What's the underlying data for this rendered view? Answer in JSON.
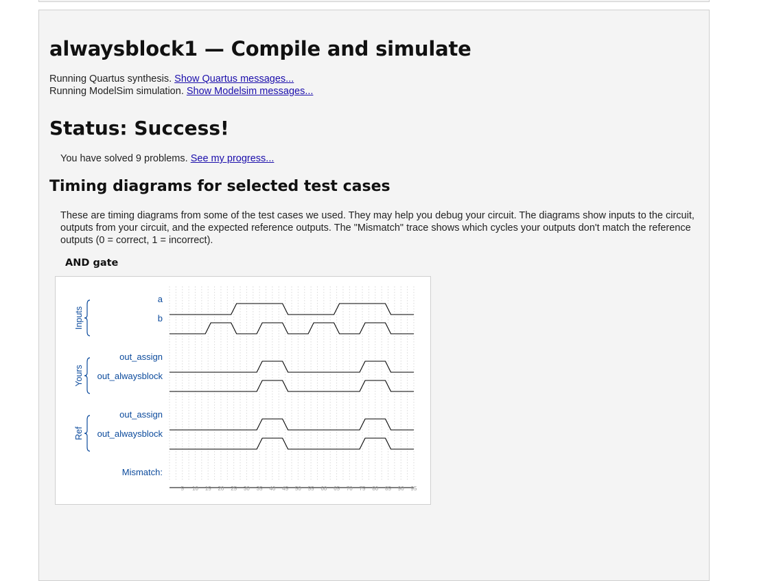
{
  "page": {
    "title": "alwaysblock1 — Compile and simulate",
    "quartus_text": "Running Quartus synthesis.",
    "quartus_link": "Show Quartus messages...",
    "modelsim_text": "Running ModelSim simulation.",
    "modelsim_link": "Show Modelsim messages...",
    "status": "Status: Success!",
    "solved_text": "You have solved 9 problems.",
    "progress_link": "See my progress...",
    "timing_heading": "Timing diagrams for selected test cases",
    "timing_description": "These are timing diagrams from some of the test cases we used. They may help you debug your circuit. The diagrams show inputs to the circuit, outputs from your circuit, and the expected reference outputs. The \"Mismatch\" trace shows which cycles your outputs don't match the reference outputs (0 = correct, 1 = incorrect).",
    "test_case_title": "AND gate"
  },
  "chart_data": {
    "type": "timing",
    "time_ticks": [
      5,
      10,
      15,
      20,
      25,
      30,
      35,
      40,
      45,
      50,
      55,
      60,
      65,
      70,
      75,
      80,
      85,
      90,
      95
    ],
    "time_range": [
      0,
      95
    ],
    "groups": [
      {
        "label": "Inputs",
        "signals": [
          {
            "name": "a",
            "transitions": [
              [
                0,
                0
              ],
              [
                25,
                1
              ],
              [
                45,
                0
              ],
              [
                65,
                1
              ],
              [
                85,
                0
              ]
            ]
          },
          {
            "name": "b",
            "transitions": [
              [
                0,
                0
              ],
              [
                15,
                1
              ],
              [
                25,
                0
              ],
              [
                35,
                1
              ],
              [
                45,
                0
              ],
              [
                55,
                1
              ],
              [
                65,
                0
              ],
              [
                75,
                1
              ],
              [
                85,
                0
              ]
            ]
          }
        ]
      },
      {
        "label": "Yours",
        "signals": [
          {
            "name": "out_assign",
            "transitions": [
              [
                0,
                0
              ],
              [
                35,
                1
              ],
              [
                45,
                0
              ],
              [
                75,
                1
              ],
              [
                85,
                0
              ]
            ]
          },
          {
            "name": "out_alwaysblock",
            "transitions": [
              [
                0,
                0
              ],
              [
                35,
                1
              ],
              [
                45,
                0
              ],
              [
                75,
                1
              ],
              [
                85,
                0
              ]
            ]
          }
        ]
      },
      {
        "label": "Ref",
        "signals": [
          {
            "name": "out_assign",
            "transitions": [
              [
                0,
                0
              ],
              [
                35,
                1
              ],
              [
                45,
                0
              ],
              [
                75,
                1
              ],
              [
                85,
                0
              ]
            ]
          },
          {
            "name": "out_alwaysblock",
            "transitions": [
              [
                0,
                0
              ],
              [
                35,
                1
              ],
              [
                45,
                0
              ],
              [
                75,
                1
              ],
              [
                85,
                0
              ]
            ]
          }
        ]
      }
    ],
    "mismatch": {
      "name": "Mismatch:",
      "transitions": [
        [
          0,
          0
        ]
      ]
    }
  }
}
